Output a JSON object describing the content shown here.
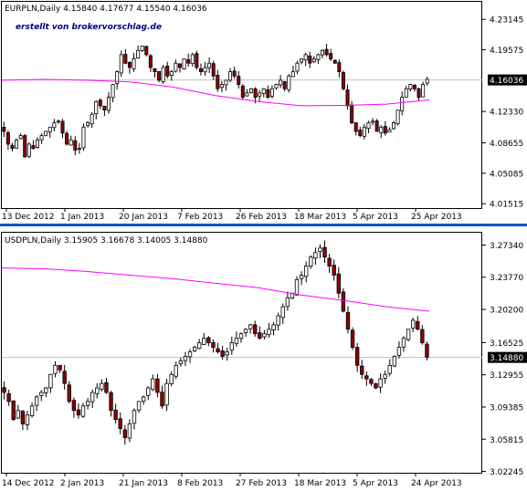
{
  "colors": {
    "background": "#ffffff",
    "axis": "#000000",
    "candle_up": "#ffffff",
    "candle_down": "#8b0000",
    "candle_outline": "#000000",
    "moving_average": "#ff00ff",
    "current_price_line": "#c0c0c0",
    "price_tag_bg": "#000000",
    "price_tag_text": "#ffffff",
    "separator": "#0055cc",
    "watermark": "#000080"
  },
  "chart_data": [
    {
      "type": "candlestick",
      "symbol_header": "EURPLN,Daily  4.15840 4.17677 4.15540 4.16036",
      "watermark": "erstellt von brokervorschlag.de",
      "current_price": "4.16036",
      "ylim": [
        4.01,
        4.252
      ],
      "y_ticks": [
        "4.23145",
        "4.19575",
        "4.16036",
        "4.12330",
        "4.08655",
        "4.05085",
        "4.01515"
      ],
      "x_ticks": [
        "13 Dec 2012",
        "1 Jan 2013",
        "20 Jan 2013",
        "7 Feb 2013",
        "26 Feb 2013",
        "18 Mar 2013",
        "5 Apr 2013",
        "25 Apr 2013"
      ],
      "grid": false,
      "close": [
        4.1,
        4.085,
        4.08,
        4.09,
        4.095,
        4.07,
        4.085,
        4.08,
        4.09,
        4.095,
        4.1,
        4.105,
        4.11,
        4.112,
        4.098,
        4.085,
        4.09,
        4.078,
        4.08,
        4.105,
        4.11,
        4.12,
        4.135,
        4.13,
        4.125,
        4.14,
        4.155,
        4.17,
        4.19,
        4.18,
        4.175,
        4.185,
        4.195,
        4.2,
        4.19,
        4.175,
        4.17,
        4.16,
        4.175,
        4.165,
        4.17,
        4.18,
        4.175,
        4.185,
        4.18,
        4.19,
        4.175,
        4.17,
        4.175,
        4.18,
        4.165,
        4.15,
        4.155,
        4.16,
        4.17,
        4.165,
        4.155,
        4.14,
        4.145,
        4.15,
        4.14,
        4.145,
        4.15,
        4.14,
        4.15,
        4.155,
        4.16,
        4.15,
        4.165,
        4.17,
        4.18,
        4.185,
        4.19,
        4.18,
        4.185,
        4.19,
        4.195,
        4.19,
        4.185,
        4.18,
        4.17,
        4.15,
        4.13,
        4.11,
        4.1,
        4.095,
        4.105,
        4.11,
        4.112,
        4.1,
        4.105,
        4.098,
        4.102,
        4.11,
        4.125,
        4.14,
        4.15,
        4.155,
        4.15,
        4.14,
        4.155,
        4.161
      ],
      "ma": [
        4.16,
        4.161,
        4.16,
        4.158,
        4.152,
        4.142,
        4.135,
        4.13,
        4.1305,
        4.132,
        4.137
      ]
    },
    {
      "type": "candlestick",
      "symbol_header": "USDPLN,Daily  3.15905 3.16678 3.14005 3.14880",
      "current_price": "3.14880",
      "ylim": [
        3.021,
        3.287
      ],
      "y_ticks": [
        "3.27340",
        "3.23770",
        "3.20200",
        "3.16525",
        "3.14880",
        "3.12955",
        "3.09385",
        "3.05815",
        "3.02245"
      ],
      "x_ticks": [
        "14 Dec 2012",
        "2 Jan 2013",
        "21 Jan 2013",
        "8 Feb 2013",
        "27 Feb 2013",
        "18 Mar 2013",
        "5 Apr 2013",
        "24 Apr 2013"
      ],
      "grid": false,
      "close": [
        3.11,
        3.1,
        3.08,
        3.09,
        3.075,
        3.085,
        3.095,
        3.105,
        3.11,
        3.115,
        3.13,
        3.14,
        3.135,
        3.12,
        3.1,
        3.09,
        3.085,
        3.095,
        3.1,
        3.11,
        3.115,
        3.12,
        3.11,
        3.09,
        3.08,
        3.07,
        3.06,
        3.075,
        3.09,
        3.1,
        3.105,
        3.115,
        3.125,
        3.11,
        3.095,
        3.12,
        3.13,
        3.14,
        3.145,
        3.15,
        3.155,
        3.16,
        3.165,
        3.17,
        3.165,
        3.16,
        3.155,
        3.15,
        3.155,
        3.165,
        3.17,
        3.175,
        3.18,
        3.185,
        3.175,
        3.17,
        3.175,
        3.18,
        3.185,
        3.195,
        3.205,
        3.215,
        3.22,
        3.235,
        3.24,
        3.25,
        3.26,
        3.265,
        3.27,
        3.26,
        3.25,
        3.24,
        3.22,
        3.2,
        3.18,
        3.16,
        3.14,
        3.13,
        3.125,
        3.12,
        3.115,
        3.125,
        3.13,
        3.14,
        3.15,
        3.16,
        3.17,
        3.18,
        3.19,
        3.18,
        3.165,
        3.149
      ],
      "ma": [
        3.248,
        3.247,
        3.244,
        3.24,
        3.236,
        3.231,
        3.226,
        3.218,
        3.212,
        3.205,
        3.2
      ]
    }
  ]
}
